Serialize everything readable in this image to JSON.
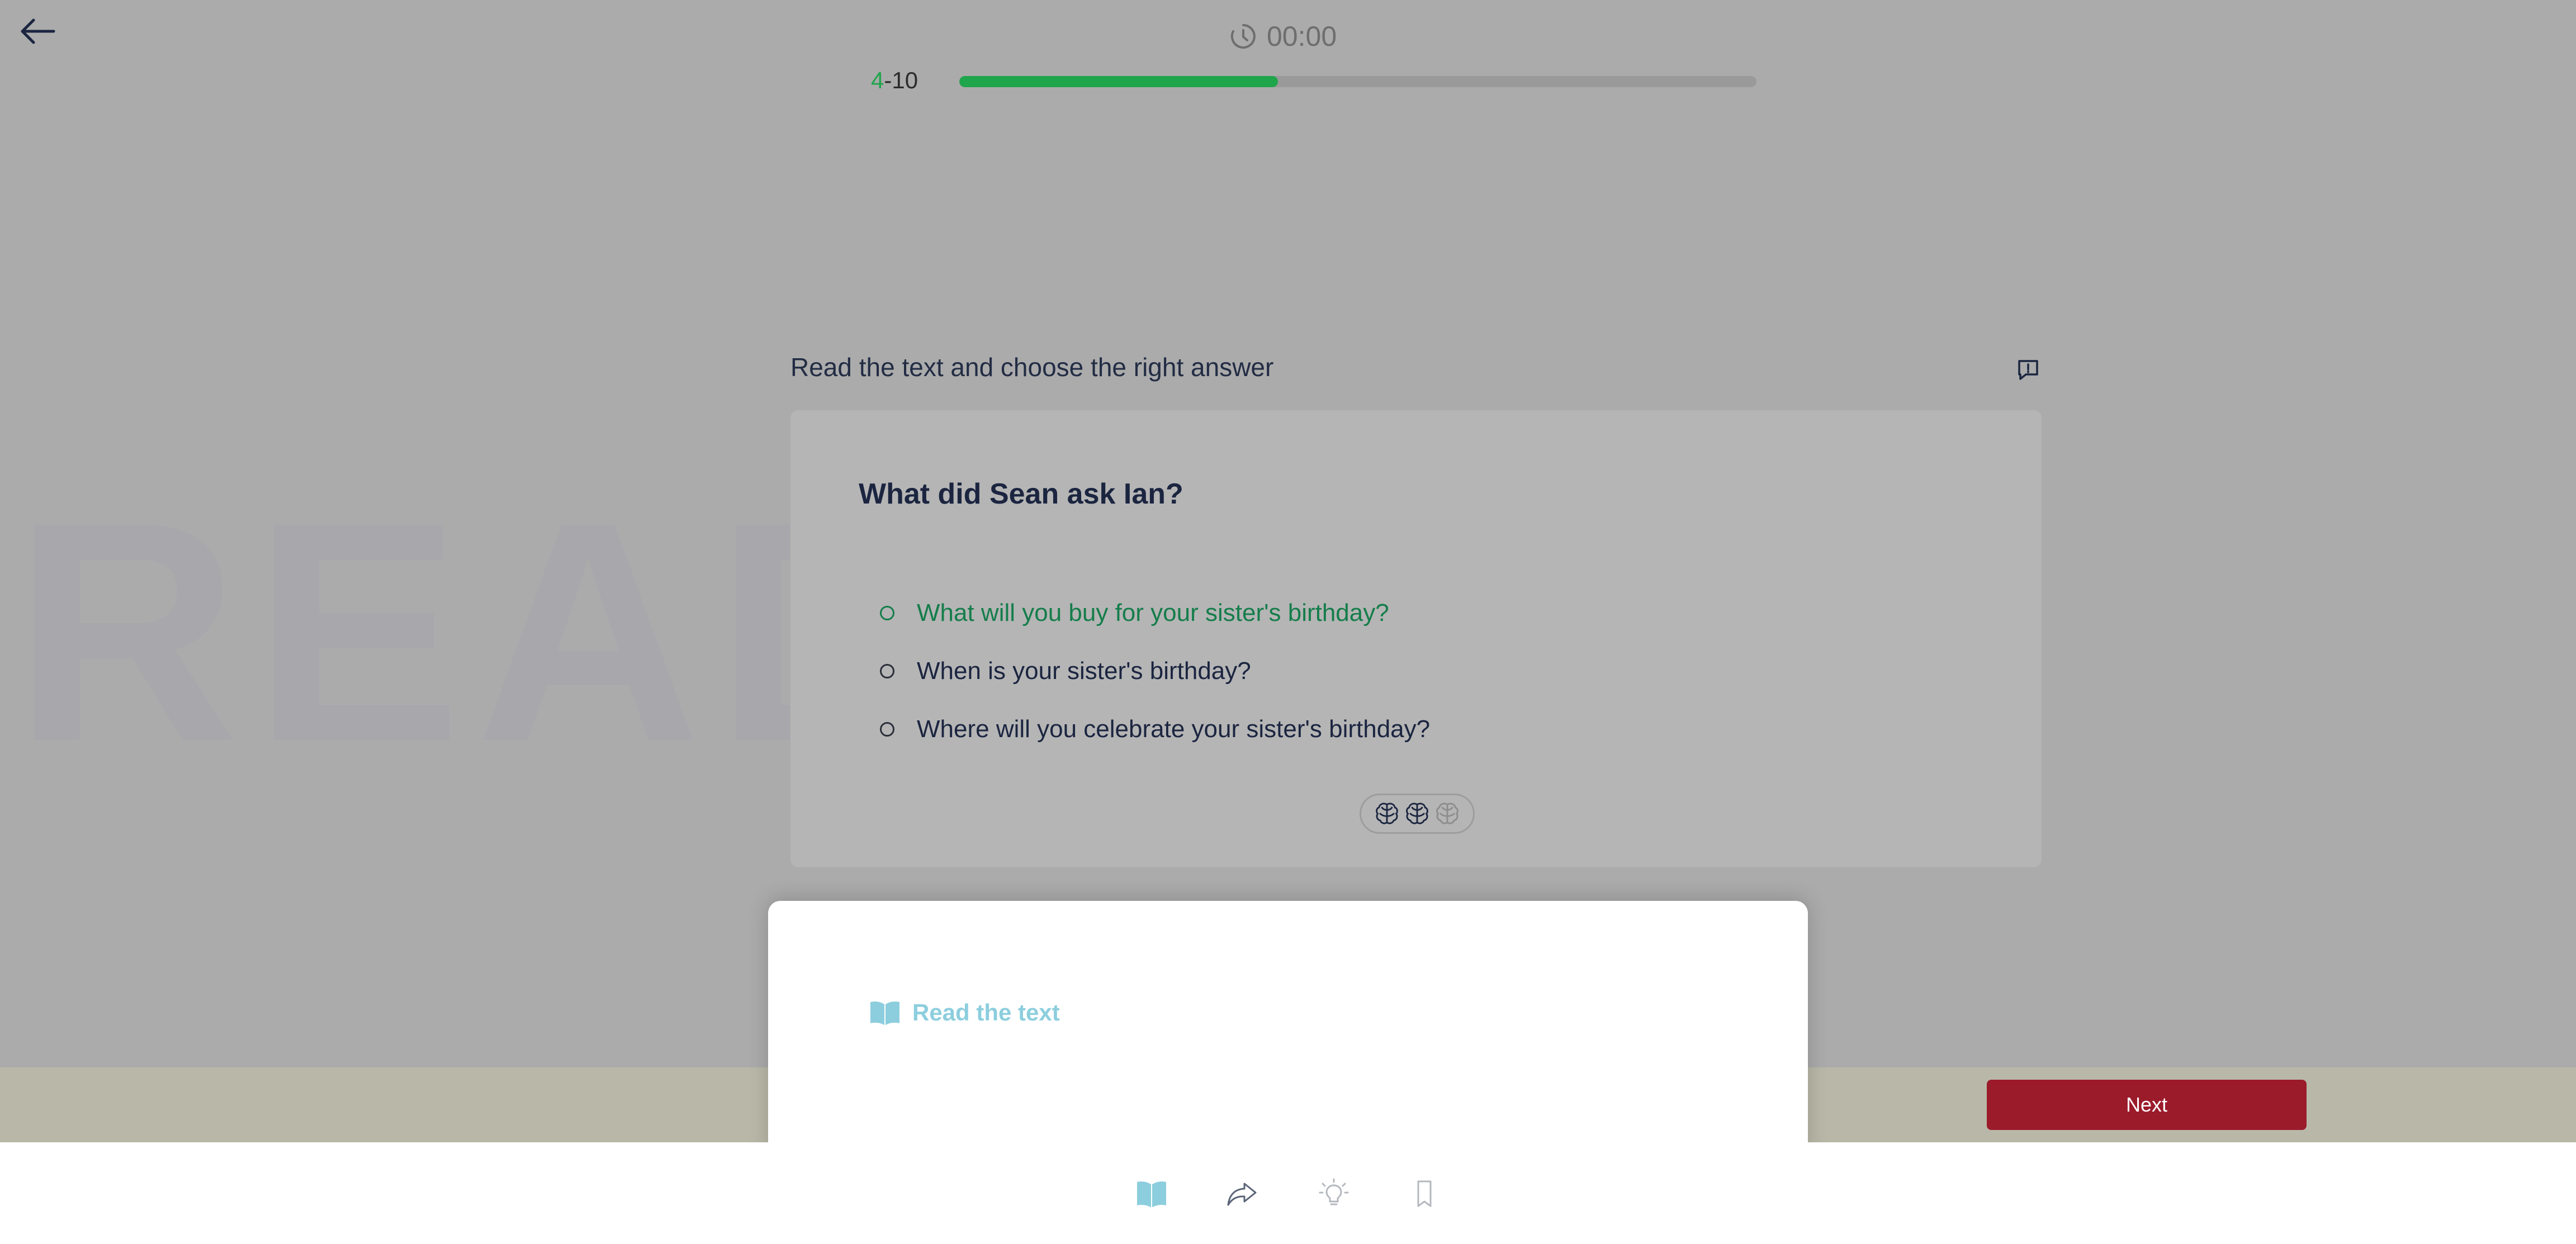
{
  "header": {
    "timer": "00:00",
    "progress": {
      "current": "4",
      "separator": "-",
      "total": "10",
      "fraction": 0.4
    }
  },
  "watermark": "READI",
  "main": {
    "instruction": "Read the text and choose the right answer",
    "question": "What did Sean ask Ian?",
    "options": [
      {
        "label": "What will you buy for your sister's birthday?",
        "selected": true
      },
      {
        "label": "When is your sister's birthday?",
        "selected": false
      },
      {
        "label": "Where will you celebrate your sister's birthday?",
        "selected": false
      }
    ],
    "difficulty": {
      "filled": 2,
      "total": 3
    }
  },
  "footer": {
    "next_label": "Next"
  },
  "popup": {
    "title": "Read the text"
  },
  "toolbar": {
    "items": [
      "book-icon",
      "share-icon",
      "lightbulb-icon",
      "bookmark-icon"
    ]
  },
  "colors": {
    "accent_green": "#1fa54b",
    "selected_option": "#157d4b",
    "next_button": "#9b1b2b",
    "popup_accent": "#8ccede"
  }
}
